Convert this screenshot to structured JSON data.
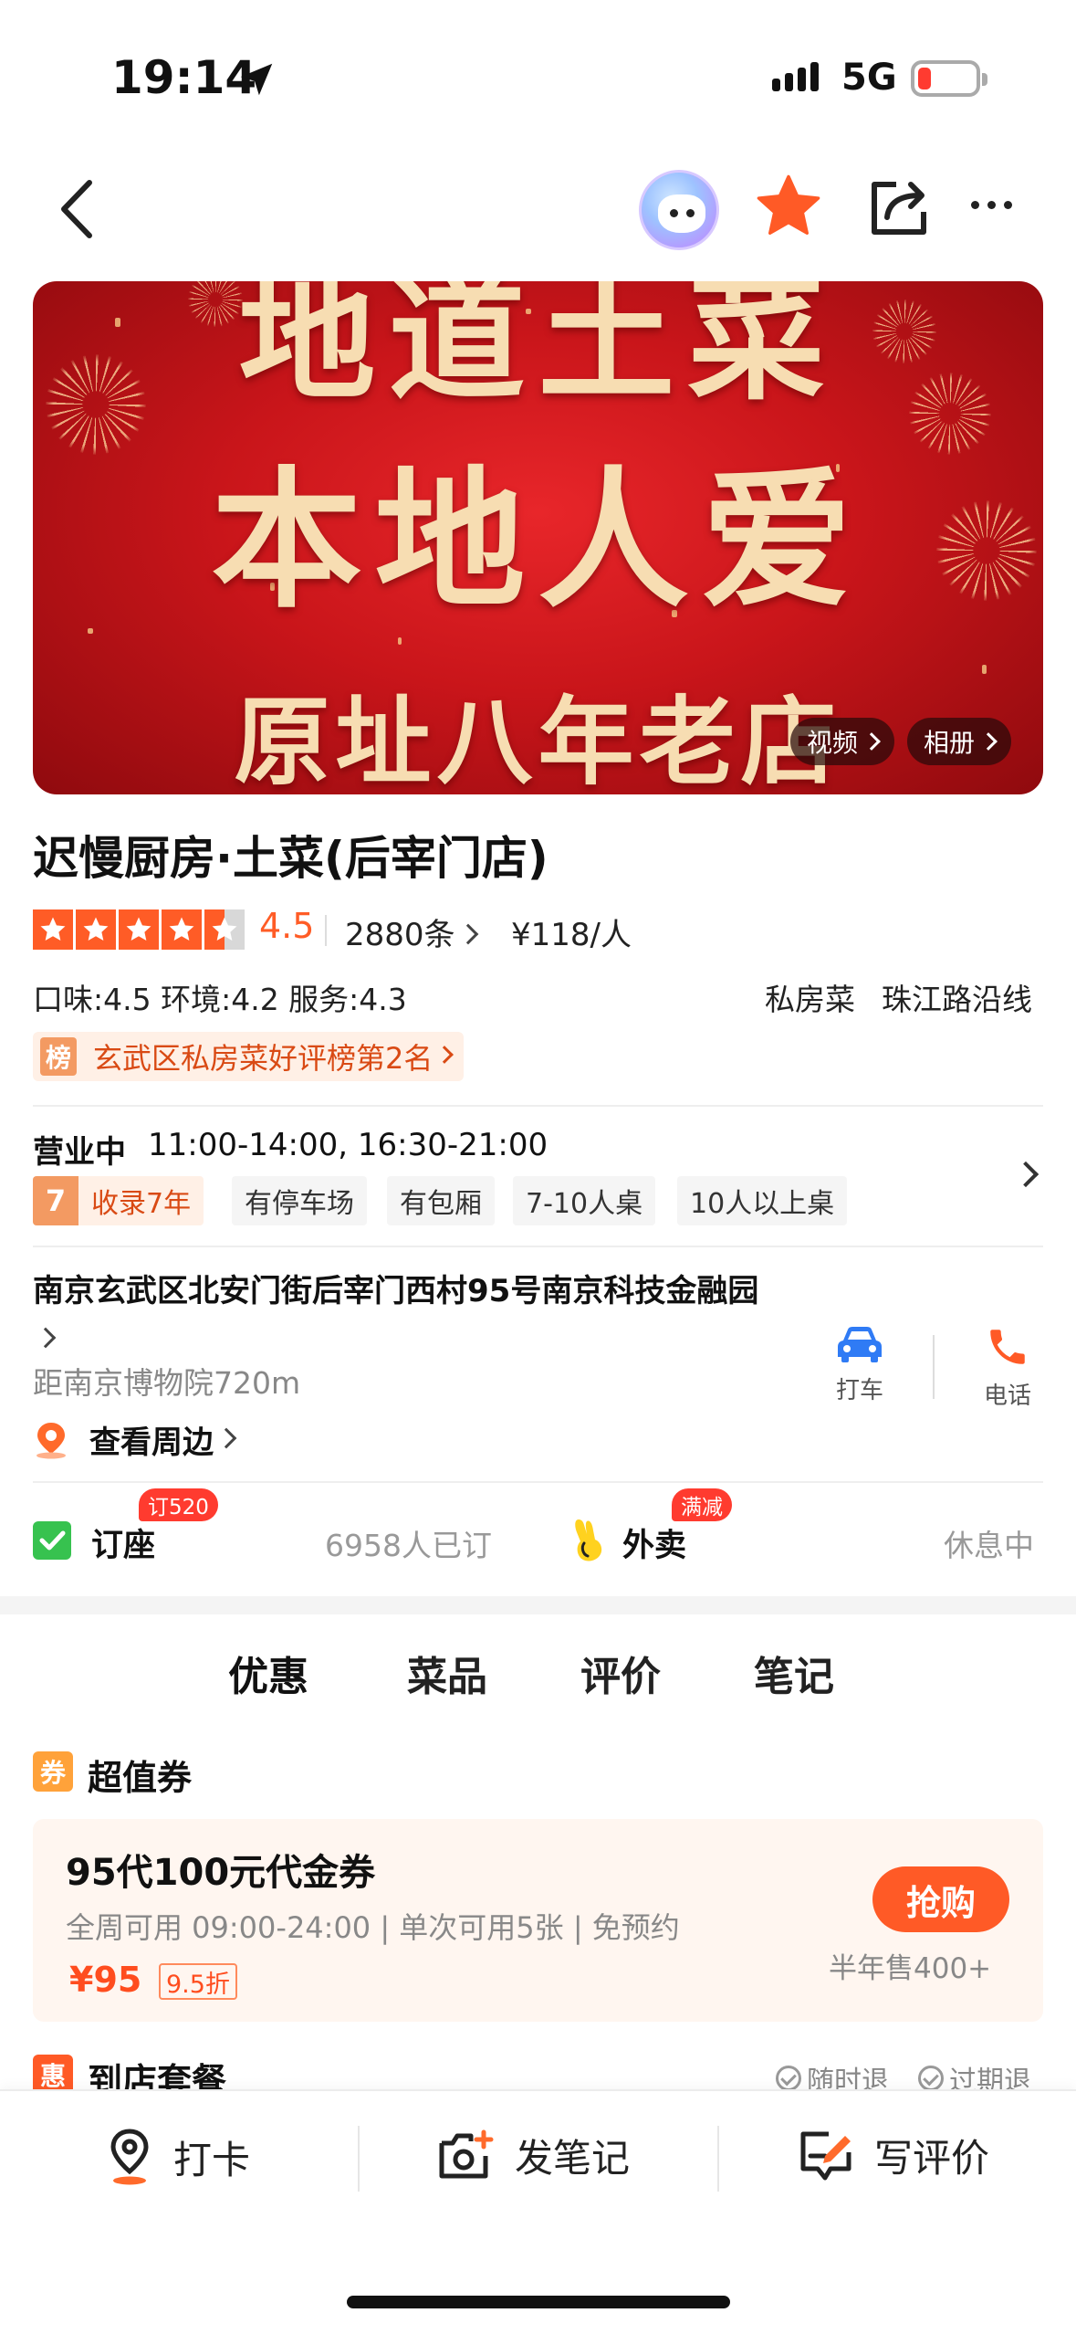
{
  "status_bar": {
    "time": "19:14",
    "network": "5G"
  },
  "banner": {
    "line1": "地道土菜",
    "line2": "本地人爱",
    "line3": "原址八年老店",
    "video_label": "视频",
    "album_label": "相册"
  },
  "shop": {
    "name": "迟慢厨房·土菜(后宰门店)",
    "rating": "4.5",
    "reviews": "2880条",
    "price": "¥118/人",
    "subscores": "口味:4.5  环境:4.2  服务:4.3",
    "cuisine": "私房菜",
    "area": "珠江路沿线",
    "rank_badge": "榜",
    "rank": "玄武区私房菜好评榜第2名"
  },
  "hours": {
    "status": "营业中",
    "time": "11:00-14:00, 16:30-21:00",
    "years_num": "7",
    "years_label": "收录7年",
    "tags": [
      "有停车场",
      "有包厢",
      "7-10人桌",
      "10人以上桌"
    ]
  },
  "location": {
    "address": "南京玄武区北安门街后宰门西村95号南京科技金融园",
    "distance": "距南京博物院720m",
    "taxi_label": "打车",
    "phone_label": "电话",
    "nearby_label": "查看周边"
  },
  "booking": {
    "label": "订座",
    "badge": "订520",
    "count": "6958人已订",
    "delivery_label": "外卖",
    "delivery_badge": "满减",
    "delivery_status": "休息中"
  },
  "tabs": [
    "优惠",
    "菜品",
    "评价",
    "笔记"
  ],
  "coupon_section": {
    "icon": "券",
    "title": "超值券",
    "coupon_title": "95代100元代金券",
    "details": "全周可用 09:00-24:00 | 单次可用5张 | 免预约",
    "price": "¥95",
    "discount": "9.5折",
    "buy_label": "抢购",
    "sold": "半年售400+"
  },
  "set_section": {
    "icon": "惠",
    "title": "到店套餐",
    "policy1": "随时退",
    "policy2": "过期退"
  },
  "bottom_bar": {
    "checkin": "打卡",
    "post_note": "发笔记",
    "write_review": "写评价"
  },
  "colors": {
    "accent": "#ff5a26",
    "banner_red": "#c9151a",
    "gold_text": "#f7ddb2",
    "book_green": "#37c24f"
  }
}
